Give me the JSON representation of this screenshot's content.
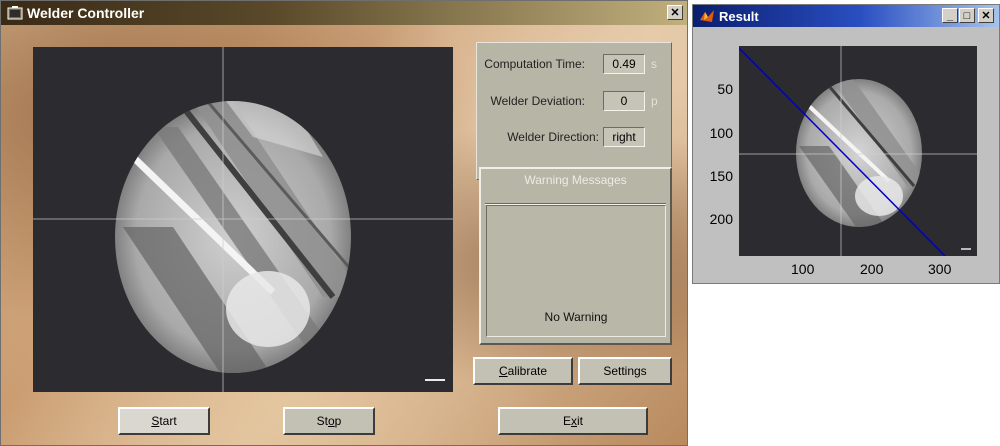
{
  "main_window": {
    "title": "Welder Controller",
    "close_glyph": "✕",
    "info": {
      "computation_time_label": "Computation Time:",
      "computation_time_value": "0.49",
      "computation_time_unit": "s",
      "welder_deviation_label": "Welder Deviation:",
      "welder_deviation_value": "0",
      "welder_deviation_unit": "p",
      "welder_direction_label": "Welder Direction:",
      "welder_direction_value": "right"
    },
    "warnings": {
      "title": "Warning Messages",
      "message": "No Warning"
    },
    "buttons": {
      "calibrate_mnemonic": "C",
      "calibrate_rest": "alibrate",
      "settings": "Settings",
      "start_mnemonic": "S",
      "start_rest": "tart",
      "stop_pre": "St",
      "stop_mnemonic": "o",
      "stop_rest": "p",
      "exit_pre": "E",
      "exit_mnemonic": "x",
      "exit_rest": "it"
    }
  },
  "result_window": {
    "title": "Result",
    "minimize_glyph": "_",
    "maximize_glyph": "□",
    "close_glyph": "✕",
    "y_ticks": [
      "50",
      "100",
      "150",
      "200"
    ],
    "x_ticks": [
      "100",
      "200",
      "300"
    ],
    "line_color": "#0000c8"
  },
  "colors": {
    "main_title_gradient_start": "#3a2a16",
    "result_title_gradient_start": "#0a1e6e",
    "panel": "#b7b5a6"
  }
}
